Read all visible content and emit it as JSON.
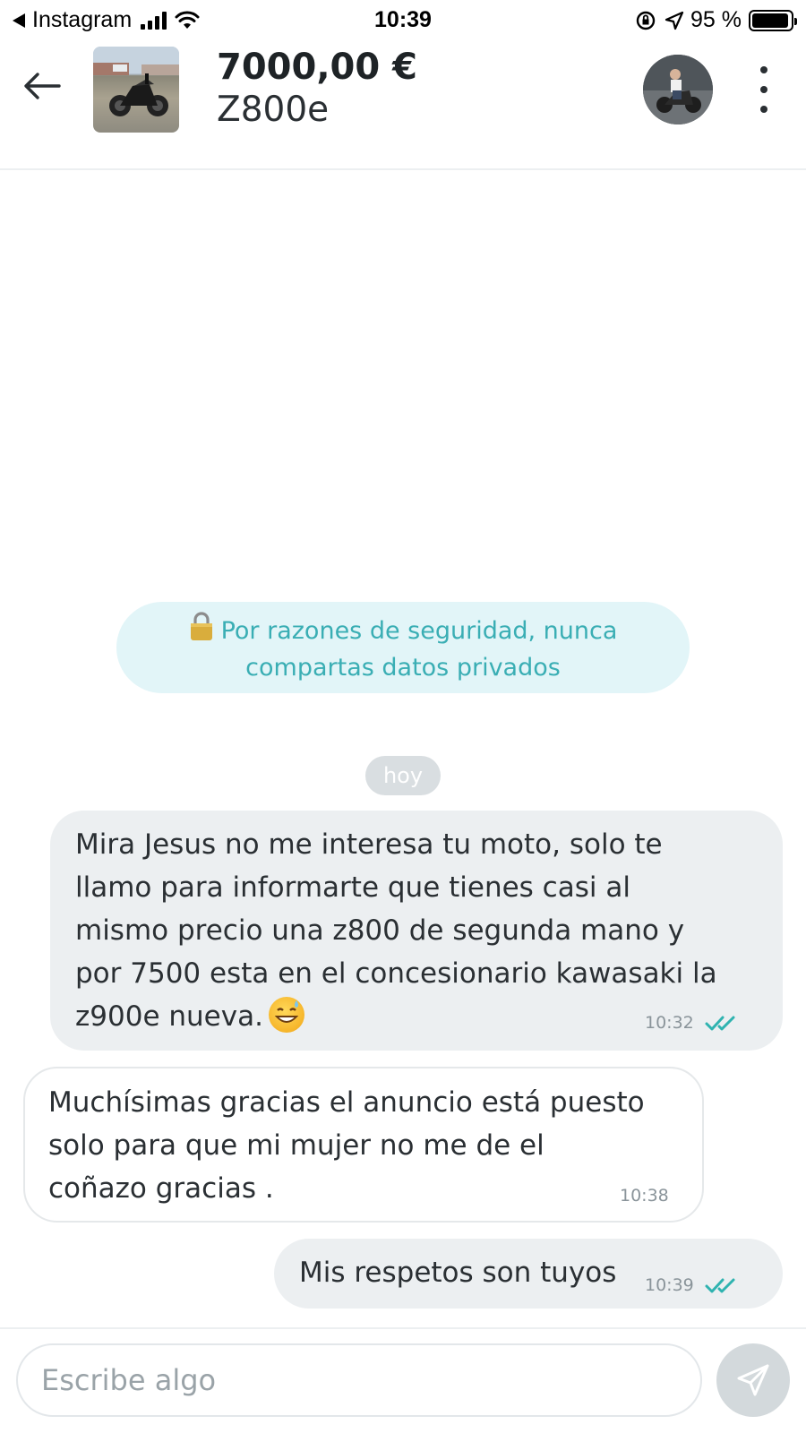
{
  "status_bar": {
    "back_app": "Instagram",
    "time": "10:39",
    "battery_percent": "95 %",
    "battery_level": 0.95
  },
  "header": {
    "price": "7000,00 €",
    "model": "Z800e"
  },
  "chat": {
    "security_notice": "Por razones de seguridad, nunca\ncompartas datos privados",
    "date_chip": "hoy",
    "messages": [
      {
        "direction": "sent",
        "text": "Mira Jesus no me interesa tu moto, solo te\nllamo para informarte que tienes casi al\nmismo precio una z800 de segunda mano y\npor 7500 esta en el concesionario kawasaki la\nz900e nueva.",
        "time": "10:32",
        "read": true
      },
      {
        "direction": "received",
        "text": "Muchísimas gracias el anuncio está puesto\nsolo para que mi mujer no me de el\ncoñazo gracias .",
        "time": "10:38"
      },
      {
        "direction": "sent",
        "text": "Mis respetos son tuyos",
        "time": "10:39",
        "read": true
      }
    ]
  },
  "composer": {
    "placeholder": "Escribe algo"
  },
  "colors": {
    "accent": "#3aaeb4",
    "notice_bg": "#e2f5f8",
    "sent_bubble": "#eceff1",
    "send_button": "#d3d9dc"
  }
}
